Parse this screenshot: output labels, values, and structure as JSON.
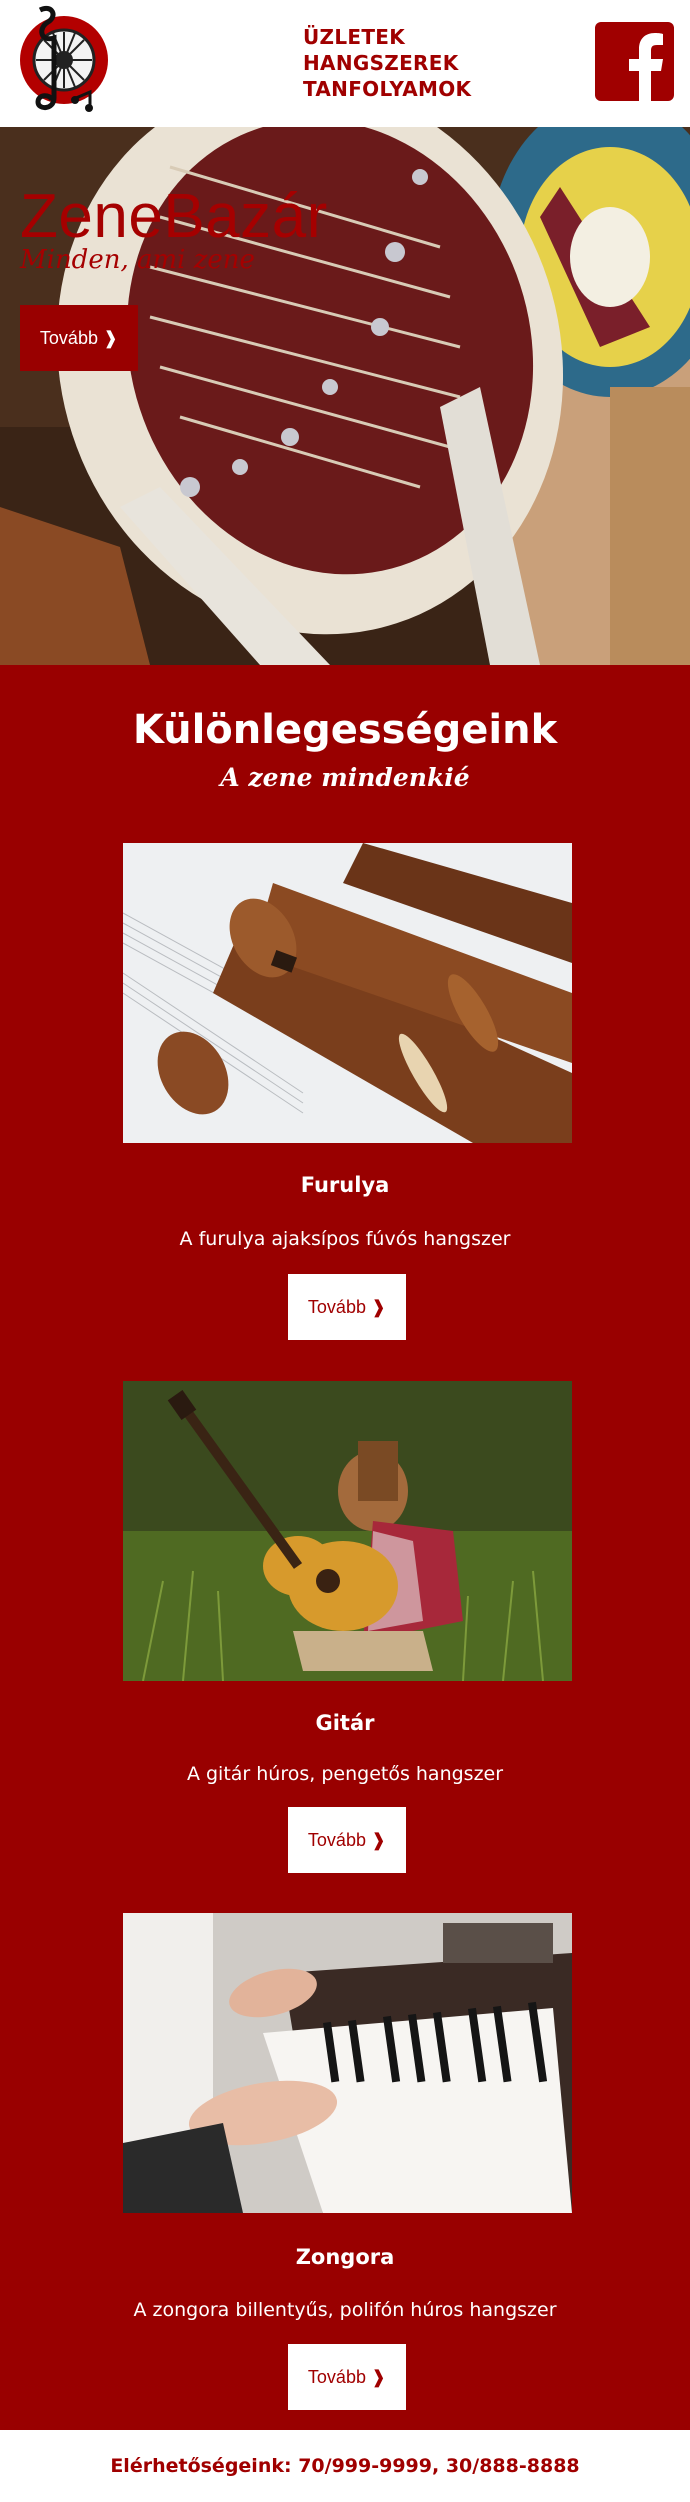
{
  "brand": {
    "accent": "#990000",
    "logo_icon": "music-note-disc-icon"
  },
  "nav": {
    "items": [
      "ÜZLETEK",
      "HANGSZEREK",
      "TANFOLYAMOK"
    ]
  },
  "social": {
    "icon": "facebook-icon"
  },
  "hero": {
    "title": "ZeneBazár",
    "subtitle": "Minden, ami zene",
    "button": "Tovább ❱"
  },
  "specials": {
    "title": "Különlegességeink",
    "subtitle": "A zene mindenkié",
    "items": [
      {
        "name": "Furulya",
        "desc": "A furulya ajaksípos fúvós hangszer",
        "button": "Tovább ❱",
        "image": "recorder-flutes-photo"
      },
      {
        "name": "Gitár",
        "desc": "A gitár húros, pengetős hangszer",
        "button": "Tovább ❱",
        "image": "girl-playing-guitar-photo"
      },
      {
        "name": "Zongora",
        "desc": "A zongora billentyűs, polifón húros hangszer",
        "button": "Tovább ❱",
        "image": "piano-playing-photo"
      }
    ]
  },
  "footer": {
    "contact": "Elérhetőségeink: 70/999-9999, 30/888-8888"
  }
}
